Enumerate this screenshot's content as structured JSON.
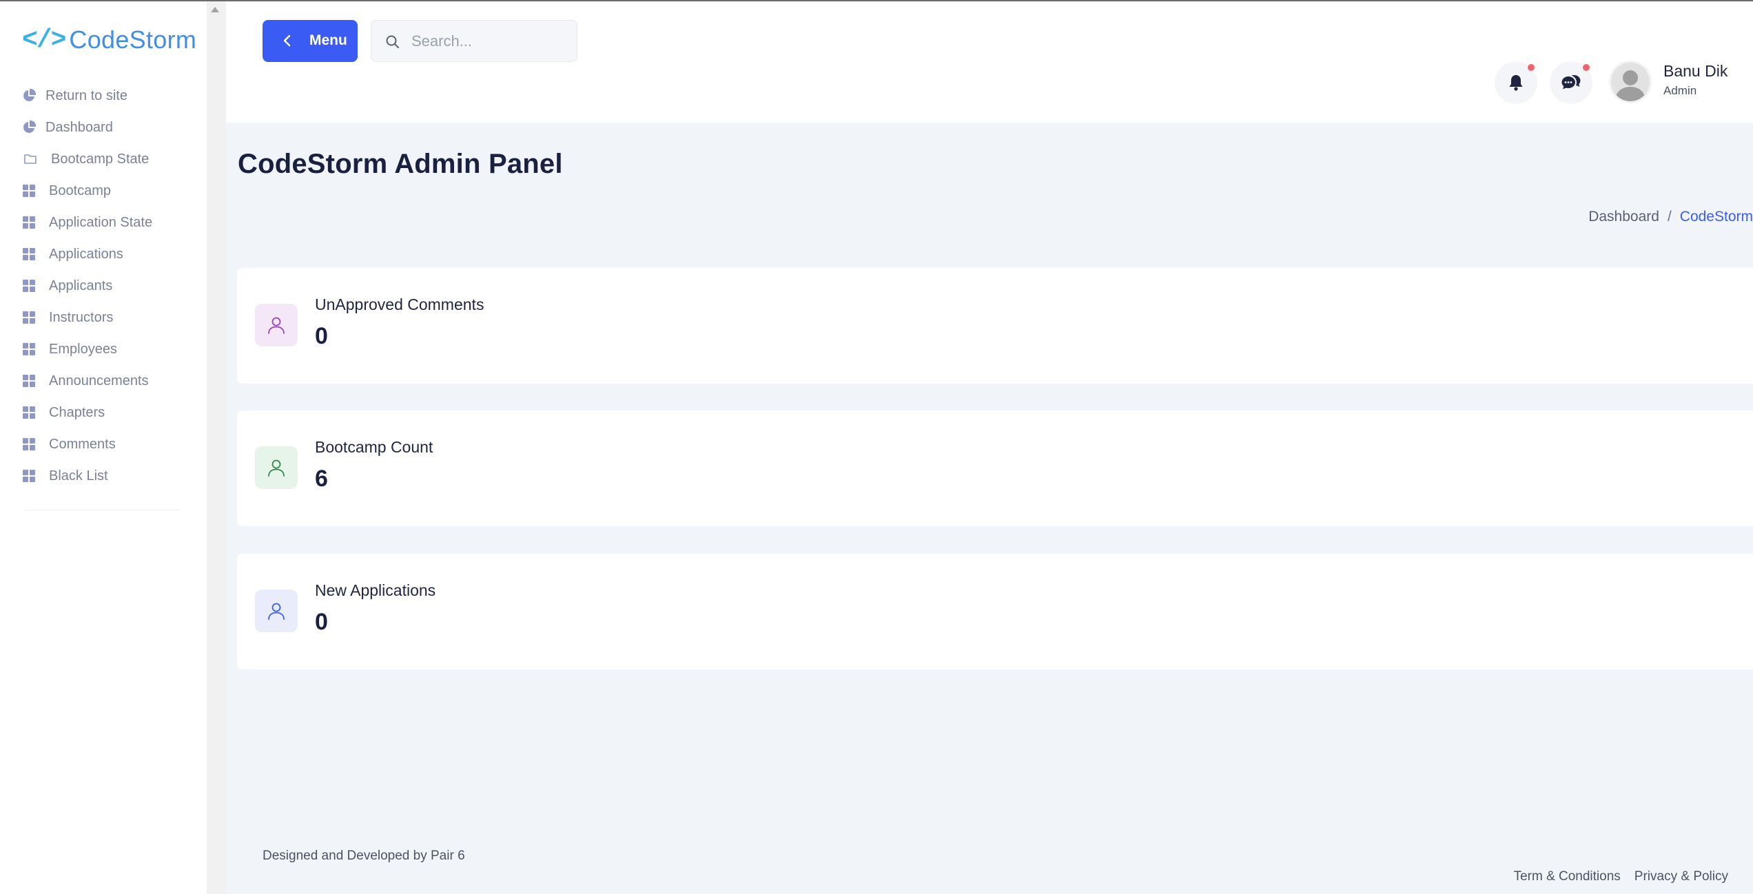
{
  "brand": {
    "logo_mark": "</>",
    "name": "CodeStorm"
  },
  "sidebar": {
    "items": [
      {
        "label": "Return to site",
        "icon": "pie-chart-icon"
      },
      {
        "label": "Dashboard",
        "icon": "pie-chart-icon"
      },
      {
        "label": "Bootcamp State",
        "icon": "folder-icon"
      },
      {
        "label": "Bootcamp",
        "icon": "grid-icon"
      },
      {
        "label": "Application State",
        "icon": "grid-icon"
      },
      {
        "label": "Applications",
        "icon": "grid-icon"
      },
      {
        "label": "Applicants",
        "icon": "grid-icon"
      },
      {
        "label": "Instructors",
        "icon": "grid-icon"
      },
      {
        "label": "Employees",
        "icon": "grid-icon"
      },
      {
        "label": "Announcements",
        "icon": "grid-icon"
      },
      {
        "label": "Chapters",
        "icon": "grid-icon"
      },
      {
        "label": "Comments",
        "icon": "grid-icon"
      },
      {
        "label": "Black List",
        "icon": "grid-icon"
      }
    ]
  },
  "header": {
    "menu_label": "Menu",
    "search_placeholder": "Search...",
    "user": {
      "name": "Banu Dik",
      "role": "Admin"
    }
  },
  "main": {
    "title": "CodeStorm Admin Panel",
    "breadcrumb": {
      "home": "Dashboard",
      "separator": "/",
      "current": "CodeStorm"
    },
    "cards": [
      {
        "title": "UnApproved Comments",
        "value": "0",
        "icon": "user-icon",
        "color": "#9b3fc4",
        "bg": "#f4e8f8"
      },
      {
        "title": "Bootcamp Count",
        "value": "6",
        "icon": "user-icon",
        "color": "#2e8a4f",
        "bg": "#e6f4ea"
      },
      {
        "title": "New Applications",
        "value": "0",
        "icon": "user-icon",
        "color": "#3a5cf4",
        "bg": "#e8ecfb"
      }
    ]
  },
  "footer": {
    "credit": "Designed and Developed by Pair 6",
    "links": [
      "Term & Conditions",
      "Privacy & Policy"
    ]
  },
  "colors": {
    "primary": "#3a5cf4",
    "sidebar_icon": "#8f97c4",
    "notification_dot": "#f0646a"
  }
}
